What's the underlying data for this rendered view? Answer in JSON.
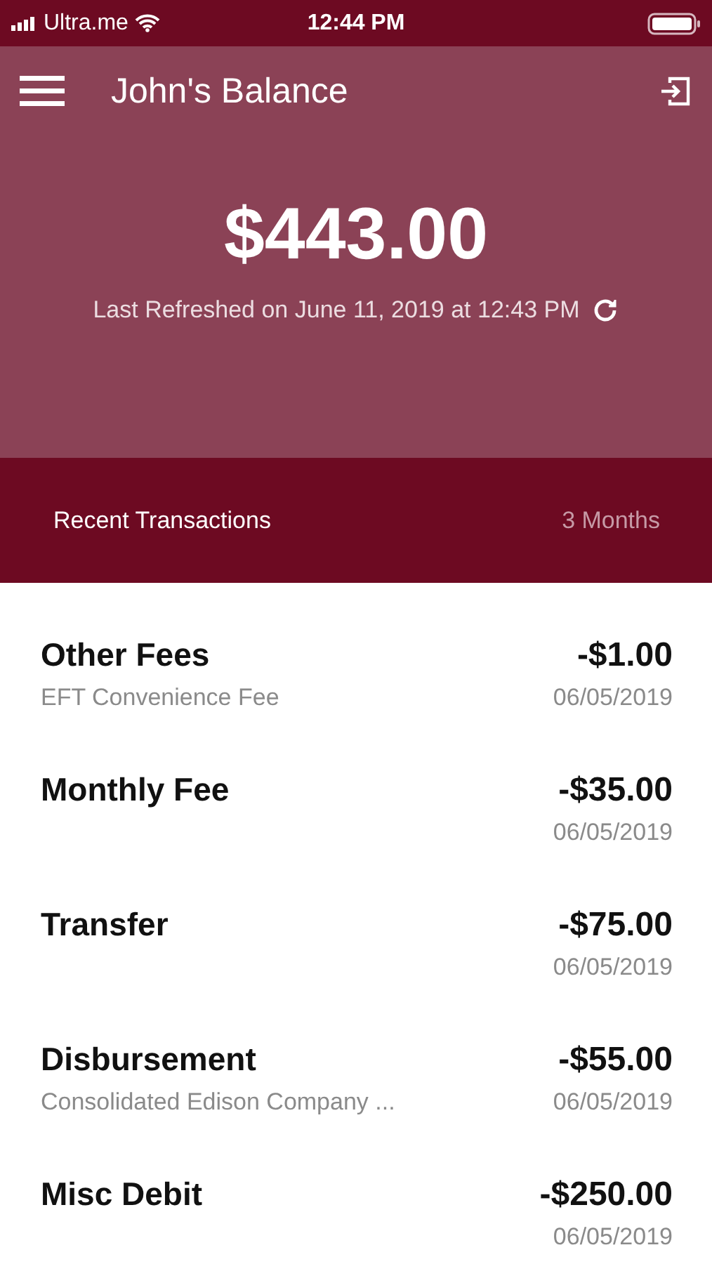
{
  "status_bar": {
    "carrier": "Ultra.me",
    "time": "12:44 PM"
  },
  "header": {
    "title": "John's Balance"
  },
  "balance": {
    "amount": "$443.00",
    "refreshed": "Last Refreshed on June 11, 2019 at 12:43 PM"
  },
  "section": {
    "title": "Recent Transactions",
    "period": "3 Months"
  },
  "transactions": [
    {
      "title": "Other Fees",
      "description": "EFT Convenience Fee",
      "amount": "-$1.00",
      "date": "06/05/2019"
    },
    {
      "title": "Monthly Fee",
      "amount": "-$35.00",
      "date": "06/05/2019"
    },
    {
      "title": "Transfer",
      "amount": "-$75.00",
      "date": "06/05/2019"
    },
    {
      "title": "Disbursement",
      "description": "Consolidated Edison Company ...",
      "amount": "-$55.00",
      "date": "06/05/2019"
    },
    {
      "title": "Misc Debit",
      "amount": "-$250.00",
      "date": "06/05/2019"
    }
  ]
}
